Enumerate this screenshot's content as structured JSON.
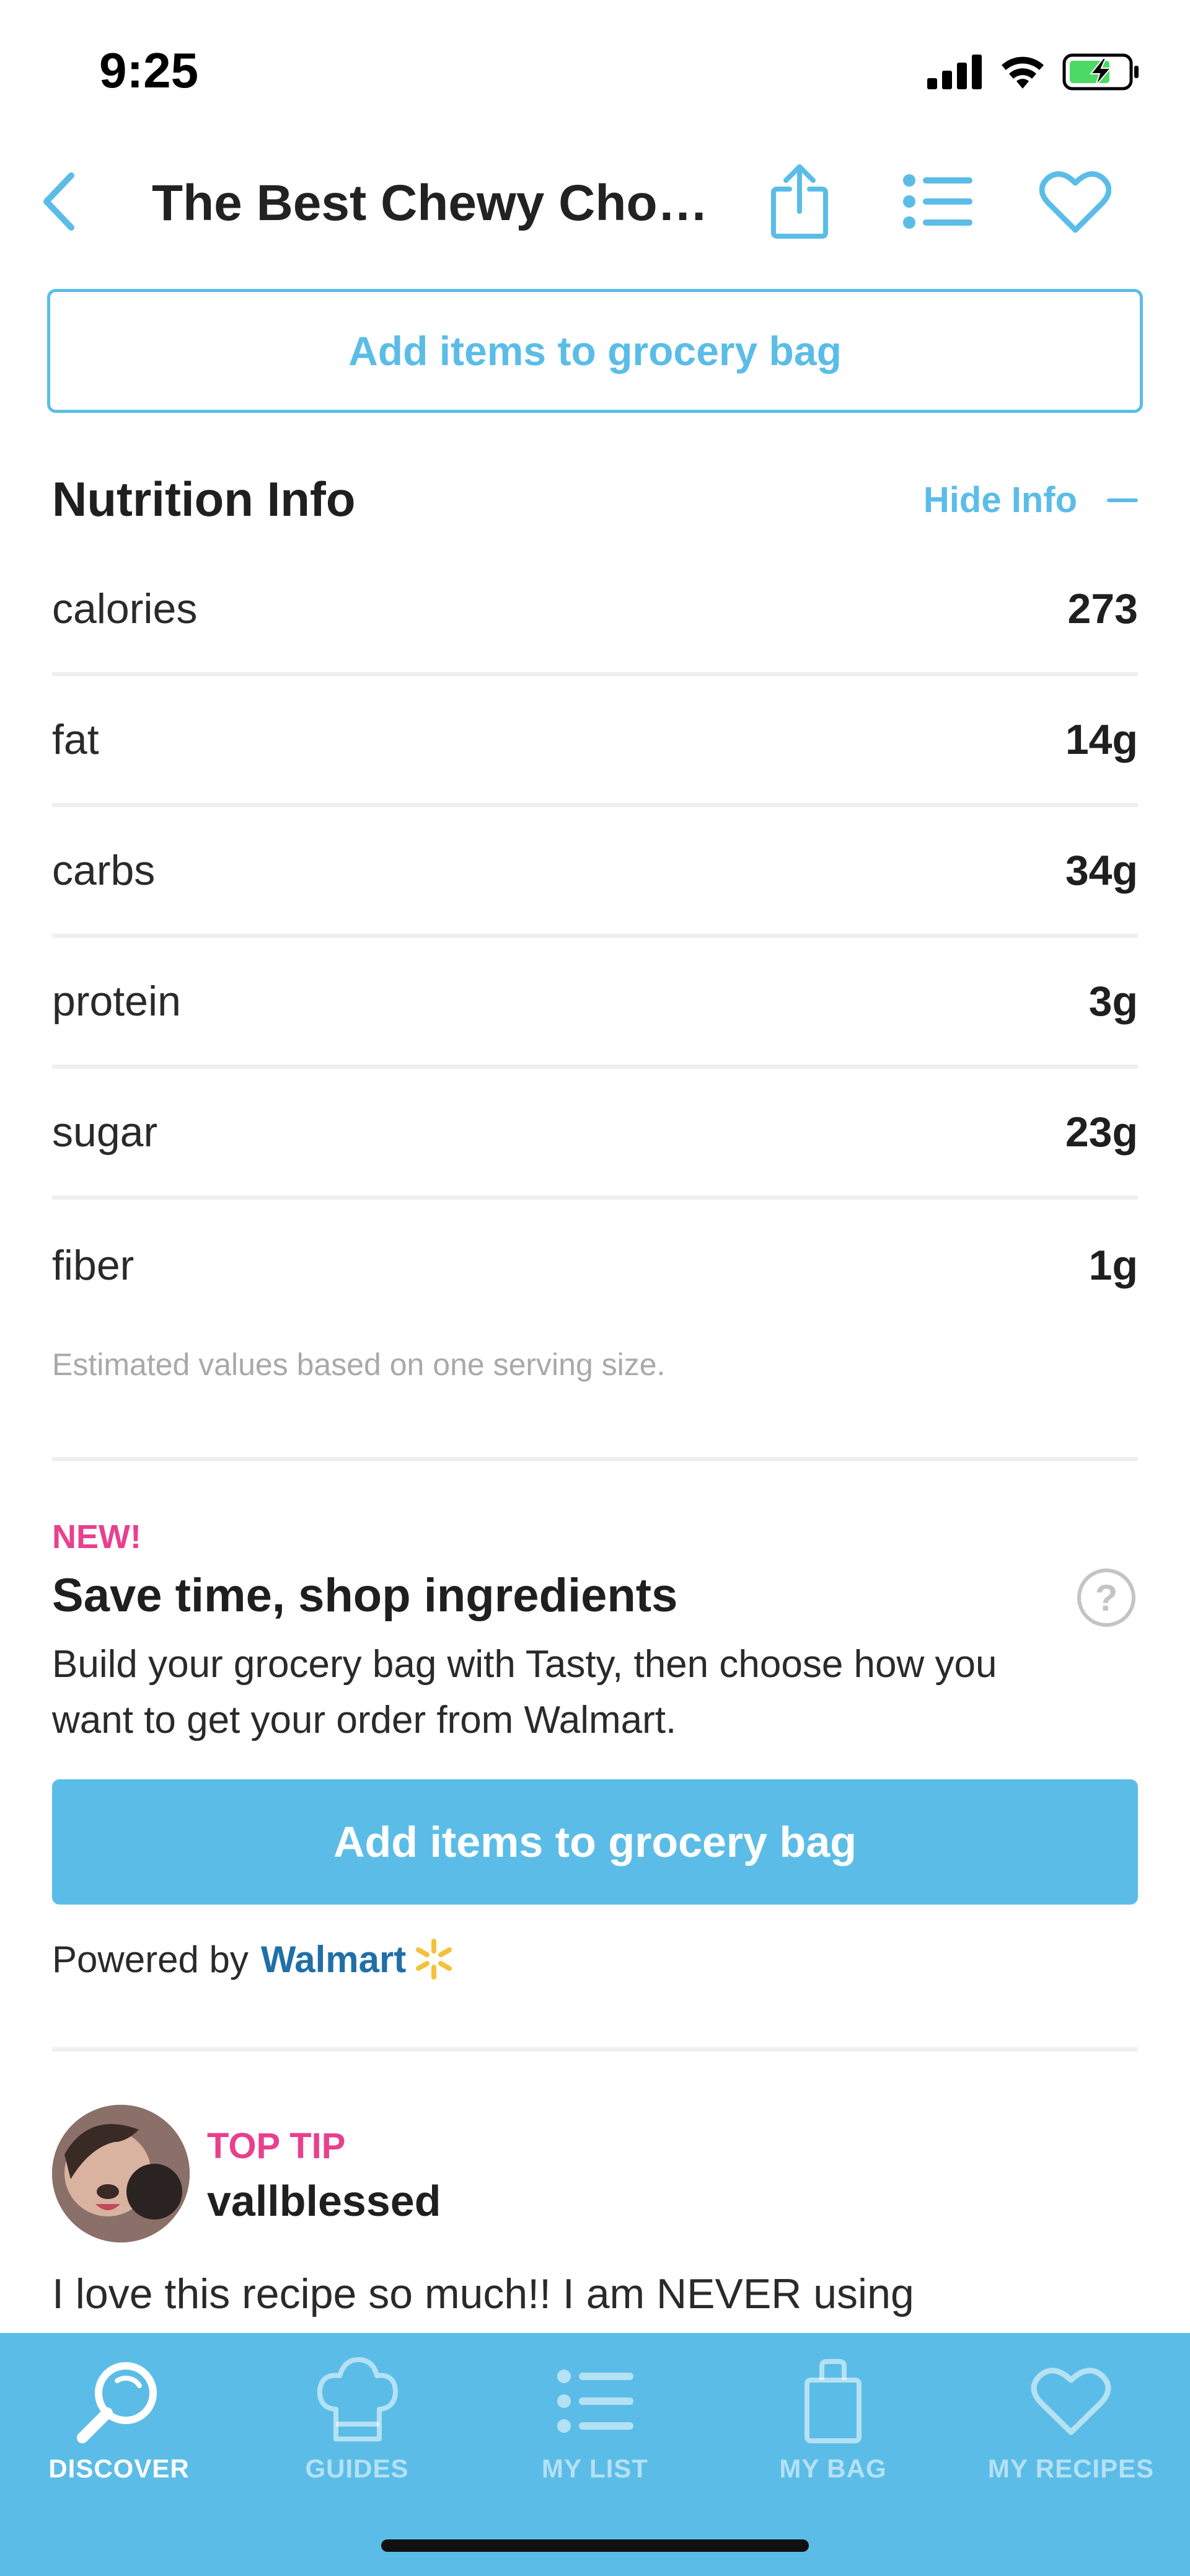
{
  "status_bar": {
    "time": "9:25"
  },
  "nav": {
    "title": "The Best Chewy Choc..."
  },
  "grocery_button_top": {
    "label": "Add items to grocery bag"
  },
  "nutrition": {
    "title": "Nutrition Info",
    "toggle_label": "Hide Info",
    "rows": [
      {
        "name": "calories",
        "value": "273"
      },
      {
        "name": "fat",
        "value": "14g"
      },
      {
        "name": "carbs",
        "value": "34g"
      },
      {
        "name": "protein",
        "value": "3g"
      },
      {
        "name": "sugar",
        "value": "23g"
      },
      {
        "name": "fiber",
        "value": "1g"
      }
    ],
    "note": "Estimated values based on one serving size."
  },
  "promo": {
    "badge": "NEW!",
    "title": "Save time, shop ingredients",
    "help": "?",
    "description": "Build your grocery bag with Tasty, then choose how you want to get your order from Walmart.",
    "button_label": "Add items to grocery bag",
    "powered_label": "Powered by",
    "partner": "Walmart"
  },
  "top_tip": {
    "label": "TOP TIP",
    "username": "vallblessed",
    "text": "I love this recipe so much!! I am NEVER using"
  },
  "tab_bar": {
    "tabs": [
      {
        "label": "DISCOVER",
        "icon": "search-icon",
        "active": true
      },
      {
        "label": "GUIDES",
        "icon": "chef-hat-icon",
        "active": false
      },
      {
        "label": "MY LIST",
        "icon": "list-icon",
        "active": false
      },
      {
        "label": "MY BAG",
        "icon": "bag-icon",
        "active": false
      },
      {
        "label": "MY RECIPES",
        "icon": "heart-icon",
        "active": false
      }
    ]
  },
  "colors": {
    "accent": "#5bbde7",
    "pink": "#e8408e",
    "walmart_blue": "#1f6fa8",
    "walmart_yellow": "#f4c13b"
  }
}
